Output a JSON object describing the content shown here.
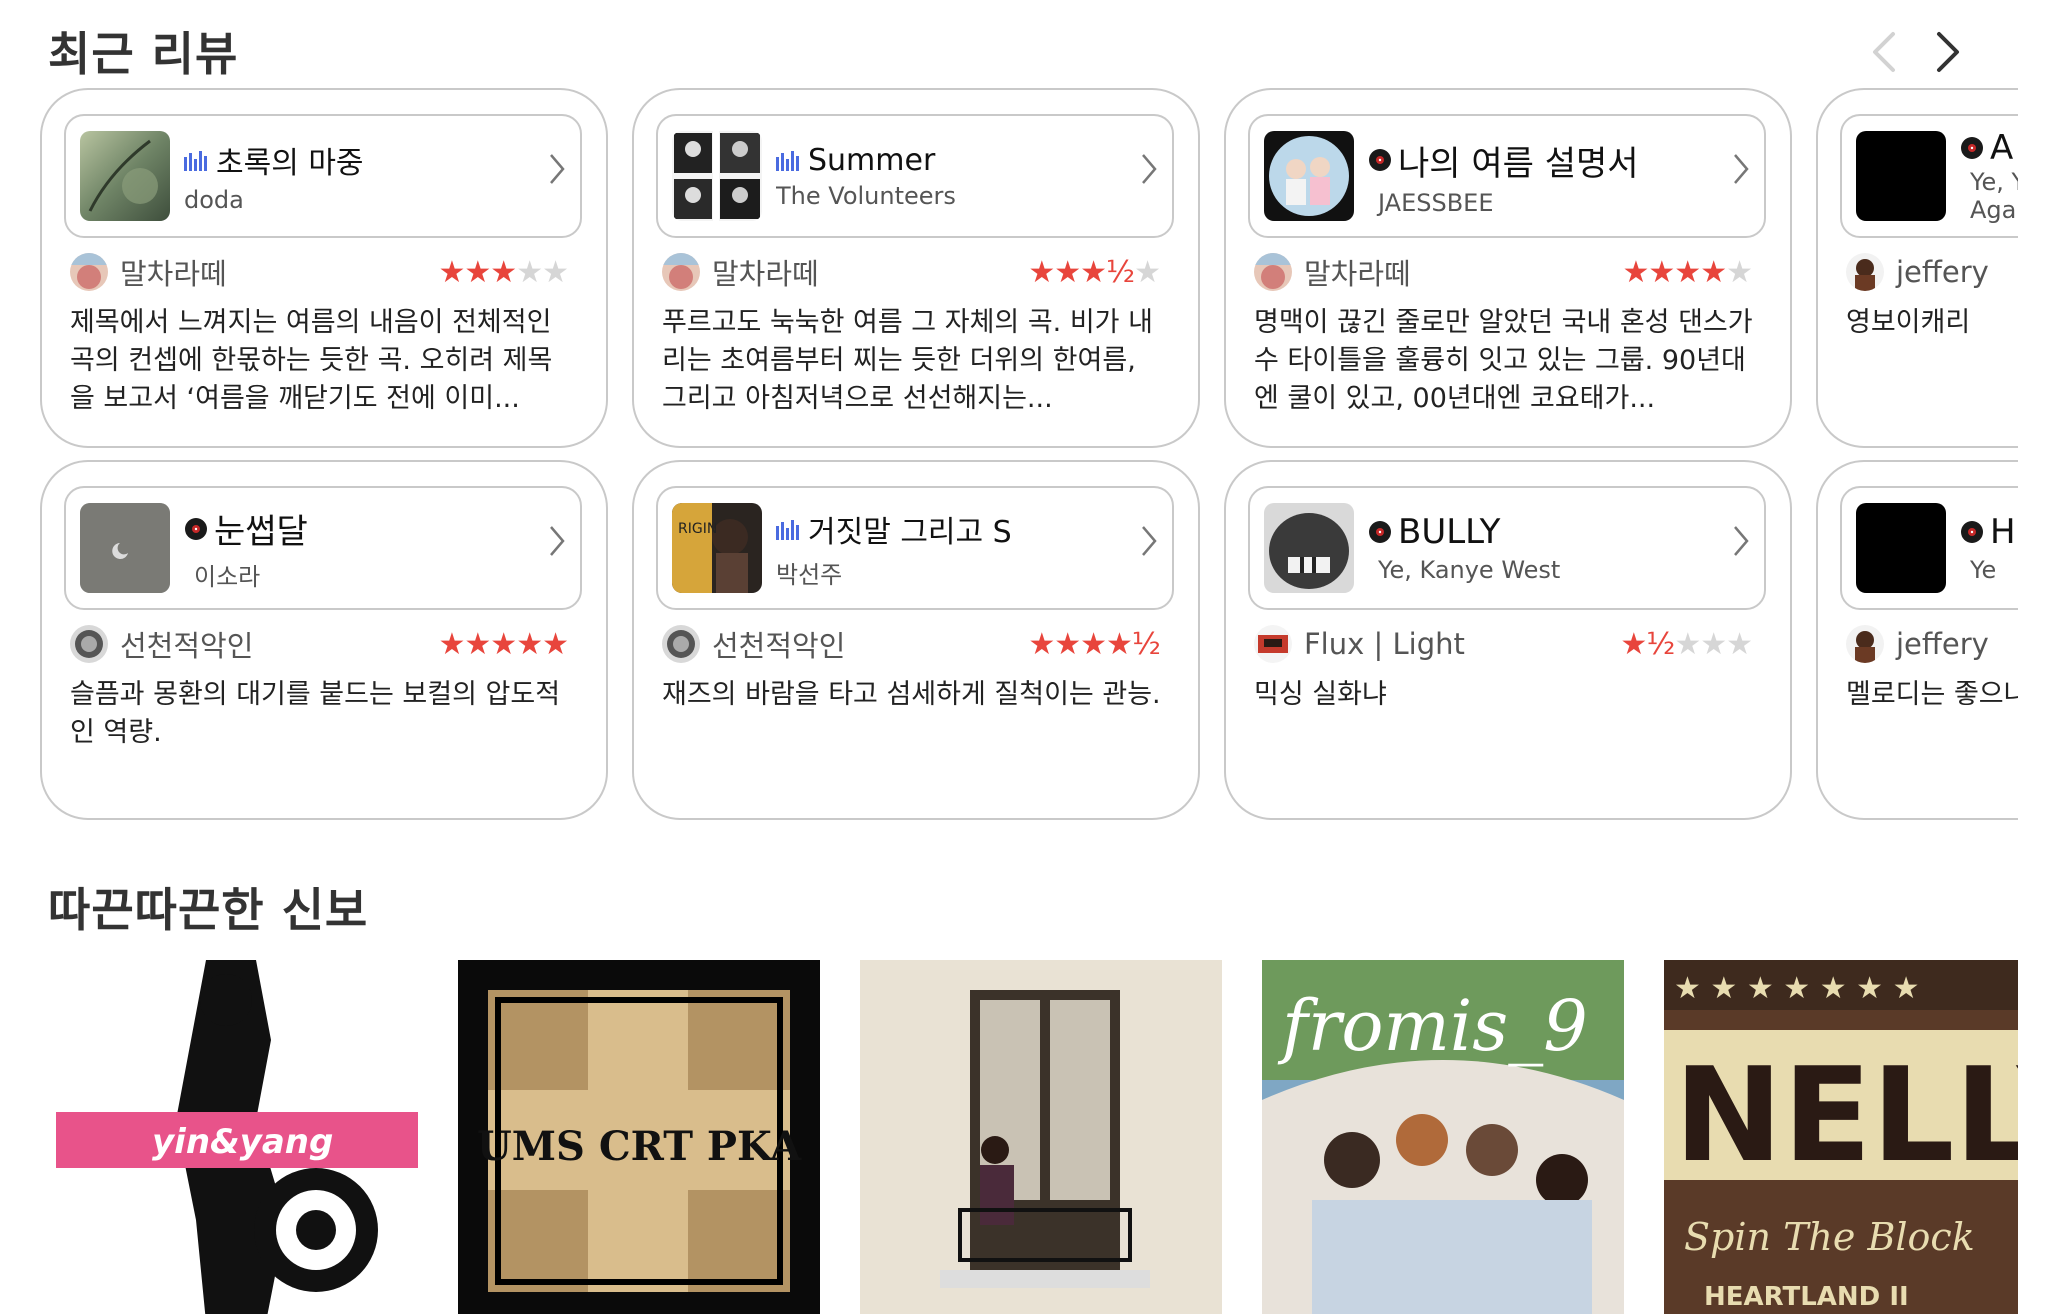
{
  "sections": {
    "recent_reviews_title": "최근 리뷰",
    "new_releases_title": "따끈따끈한 신보"
  },
  "nav": {
    "prev_icon": "chevron-left-icon",
    "next_icon": "chevron-right-icon"
  },
  "reviews": [
    {
      "album_title": "초록의 마중",
      "artist": "doda",
      "source": "melon-chart-icon",
      "reviewer": "말차라떼",
      "rating": 3,
      "text": "제목에서 느껴지는 여름의 내음이 전체적인 곡의 컨셉에 한몫하는 듯한 곡. 오히려 제목을 보고서 ‘여름을 깨닫기도 전에 이미..."
    },
    {
      "album_title": "Summer",
      "artist": "The Volunteers",
      "source": "melon-chart-icon",
      "reviewer": "말차라떼",
      "rating": 3.5,
      "text": "푸르고도 눅눅한 여름 그 자체의 곡. 비가 내리는 초여름부터 찌는 듯한 더위의 한여름, 그리고 아침저녁으로 선선해지는..."
    },
    {
      "album_title": "나의 여름 설명서",
      "artist": "JAESSBEE",
      "source": "vinyl-record-icon",
      "reviewer": "말차라떼",
      "rating": 4,
      "text": "명맥이 끊긴 줄로만 알았던 국내 혼성 댄스가수 타이틀을 훌륭히 잇고 있는 그룹. 90년대엔 쿨이 있고, 00년대엔 코요태가..."
    },
    {
      "album_title": "A",
      "artist": "Ye, Y",
      "artist_line2": "Agai",
      "source": "vinyl-record-icon",
      "reviewer": "jeffery",
      "rating": null,
      "text": "영보이캐리"
    },
    {
      "album_title": "눈썹달",
      "artist": "이소라",
      "source": "vinyl-record-icon",
      "reviewer": "선천적악인",
      "rating": 5,
      "text": "슬픔과 몽환의 대기를 붙드는 보컬의 압도적인 역량."
    },
    {
      "album_title": "거짓말 그리고 S",
      "artist": "박선주",
      "source": "melon-chart-icon",
      "reviewer": "선천적악인",
      "rating": 4.5,
      "text": "재즈의 바람을 타고 섬세하게 질척이는 관능."
    },
    {
      "album_title": "BULLY",
      "artist": "Ye, Kanye West",
      "source": "vinyl-record-icon",
      "reviewer": "Flux | Light",
      "rating": 1.5,
      "text": "믹싱 실화냐"
    },
    {
      "album_title": "H",
      "artist": "Ye",
      "source": "vinyl-record-icon",
      "reviewer": "jeffery",
      "rating": null,
      "text": "멜로디는 좋으나"
    }
  ],
  "new_releases": [
    {
      "label": "yin&yang"
    },
    {
      "label": "UMS CRT PKA"
    },
    {
      "label": ""
    },
    {
      "label": "fromis_9"
    },
    {
      "label": "NELLY",
      "subtitle": "Spin The Block",
      "footer": "HEARTLAND II"
    }
  ],
  "colors": {
    "star_on": "#e8453c",
    "star_off": "#d6d6d6",
    "card_border": "#c9c9c9",
    "chart_icon": "#4a6be0",
    "yin_yang_band": "#e8538a"
  }
}
